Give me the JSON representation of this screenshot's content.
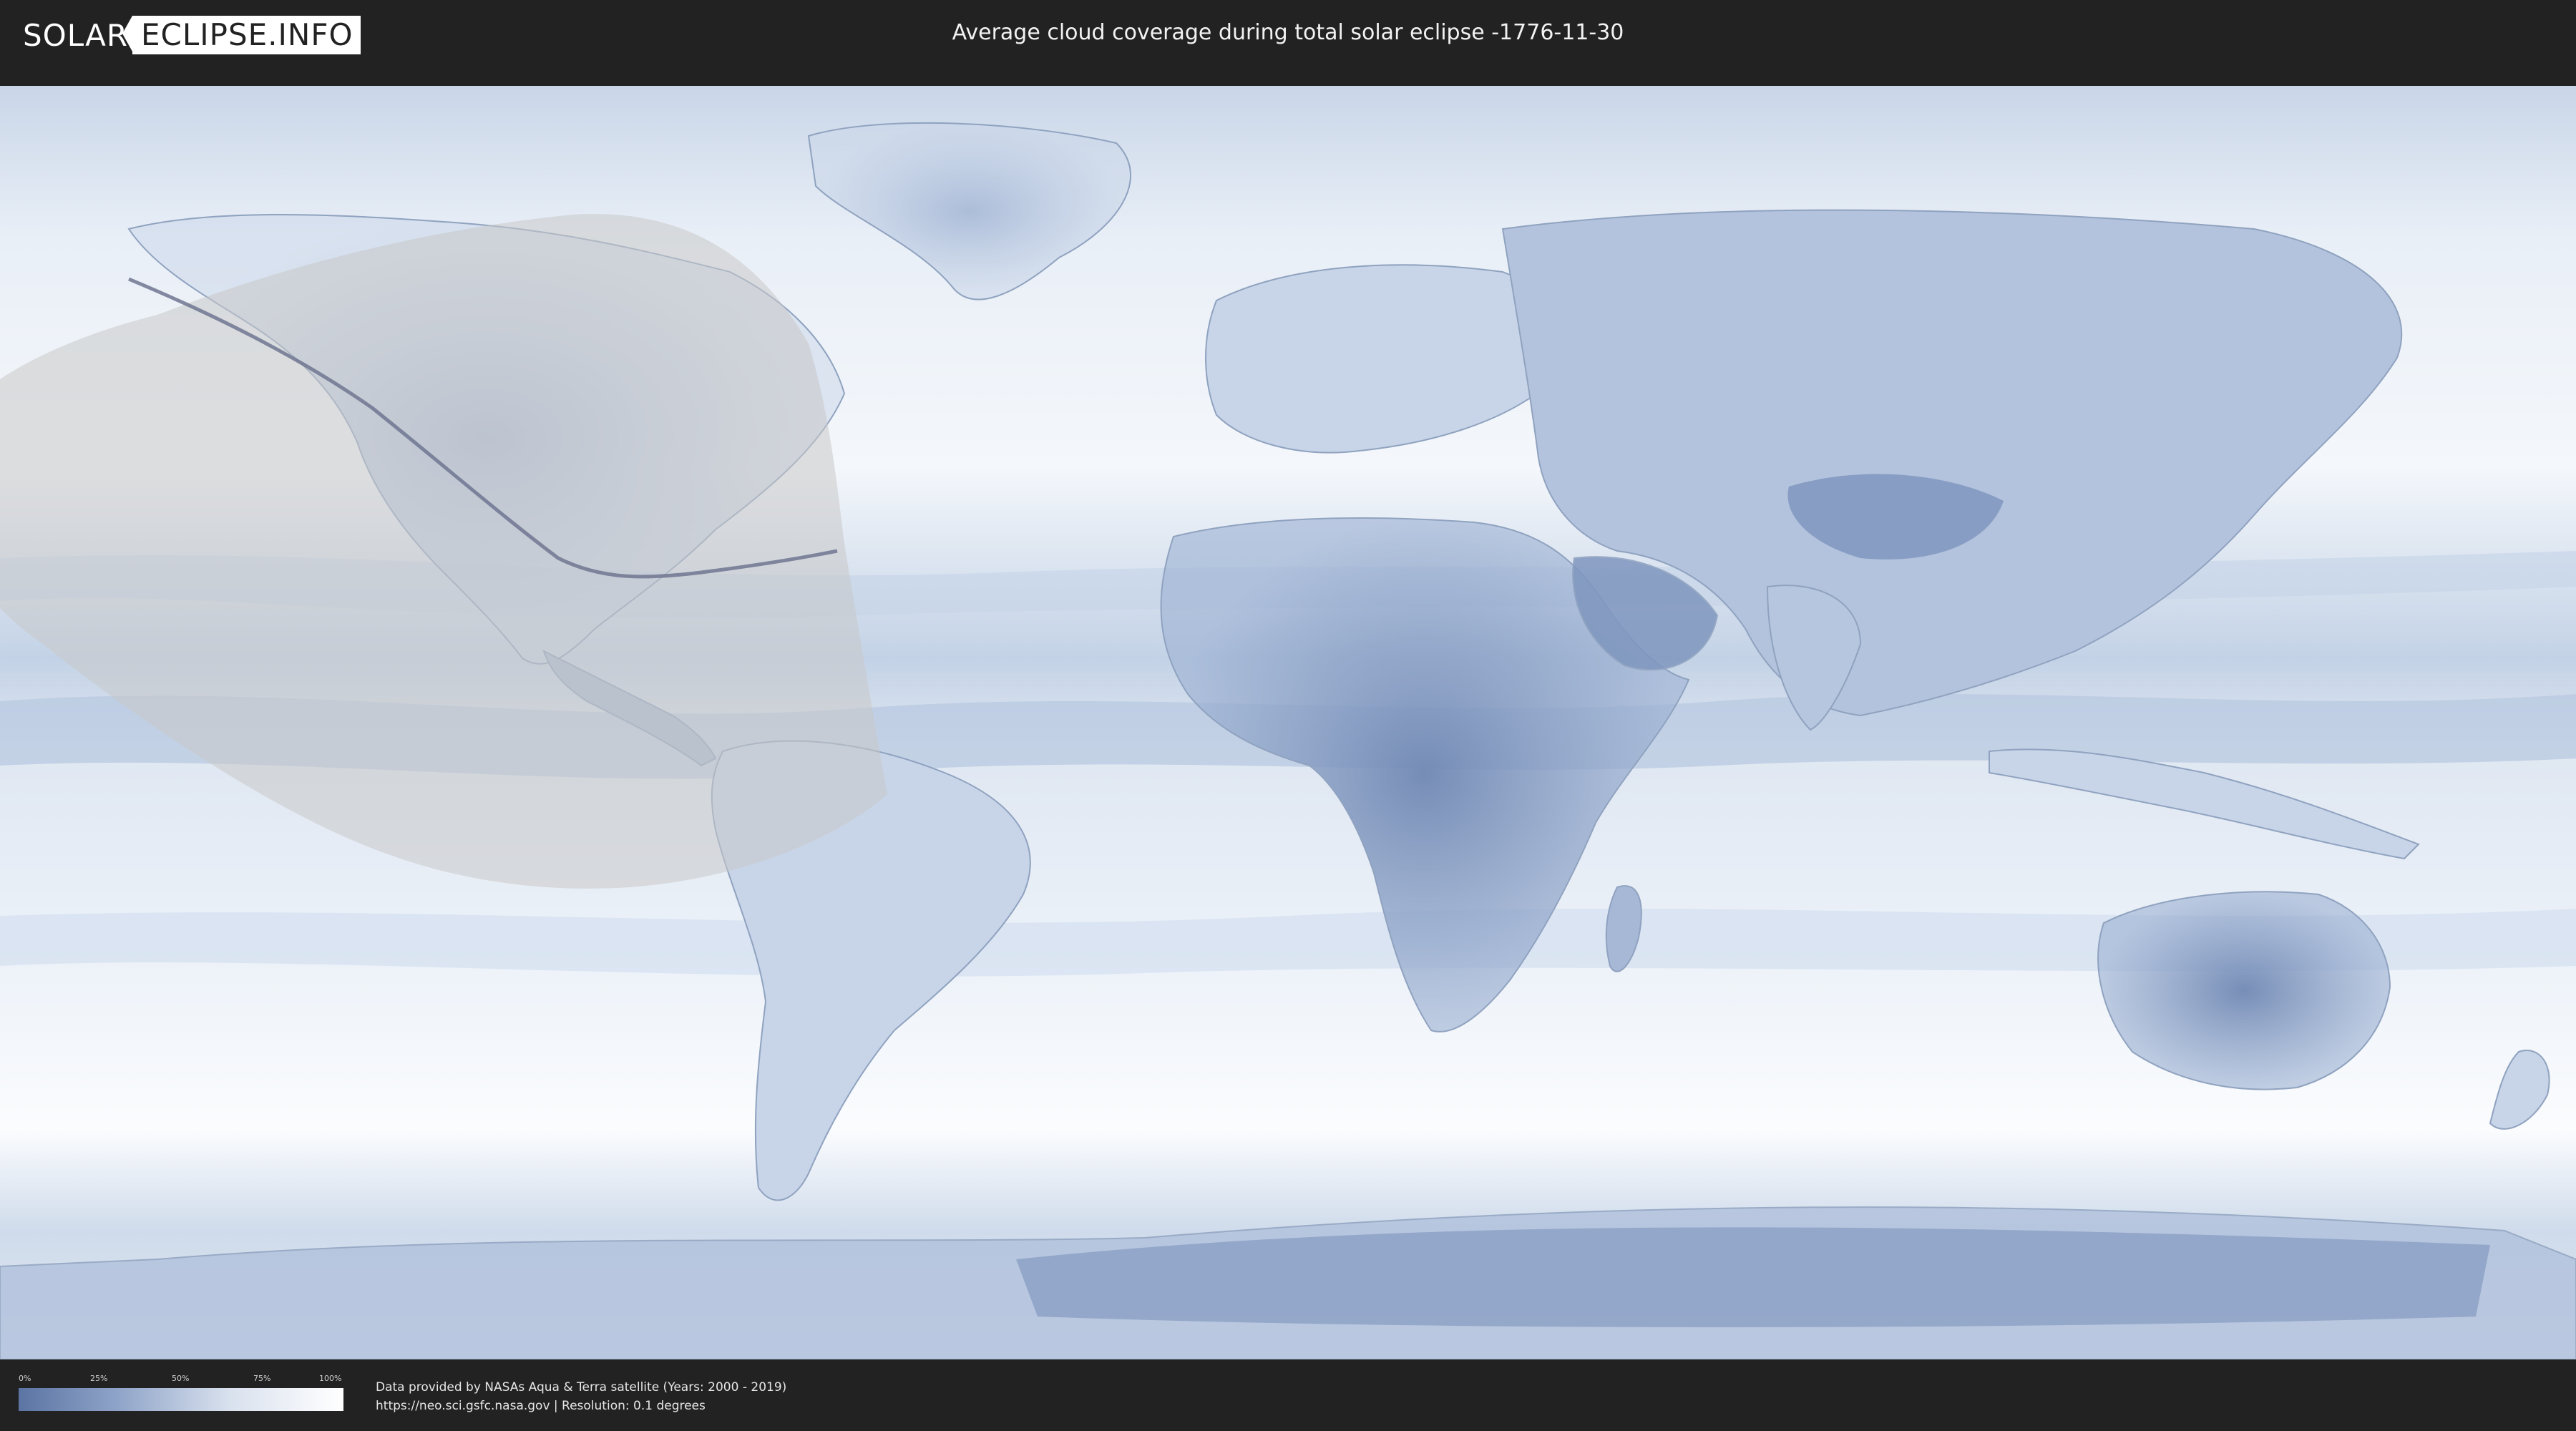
{
  "header": {
    "logo_left": "SOLAR",
    "logo_right": "ECLIPSE.INFO",
    "title": "Average cloud coverage during total solar eclipse -1776-11-30"
  },
  "legend": {
    "ticks": [
      "0%",
      "25%",
      "50%",
      "75%",
      "100%"
    ],
    "color_low": "#5b74a3",
    "color_high": "#ffffff"
  },
  "footer": {
    "credit_line1": "Data provided by NASAs Aqua & Terra satellite (Years: 2000 - 2019)",
    "credit_line2": "https://neo.sci.gsfc.nasa.gov | Resolution: 0.1 degrees"
  },
  "colors": {
    "ocean_light": "#e8eef6",
    "cloud_dense": "#f7f9fc",
    "clear_sky": "#7f96be",
    "eclipse_overlay": "#c9c9c9",
    "path_line": "#6e7690"
  }
}
